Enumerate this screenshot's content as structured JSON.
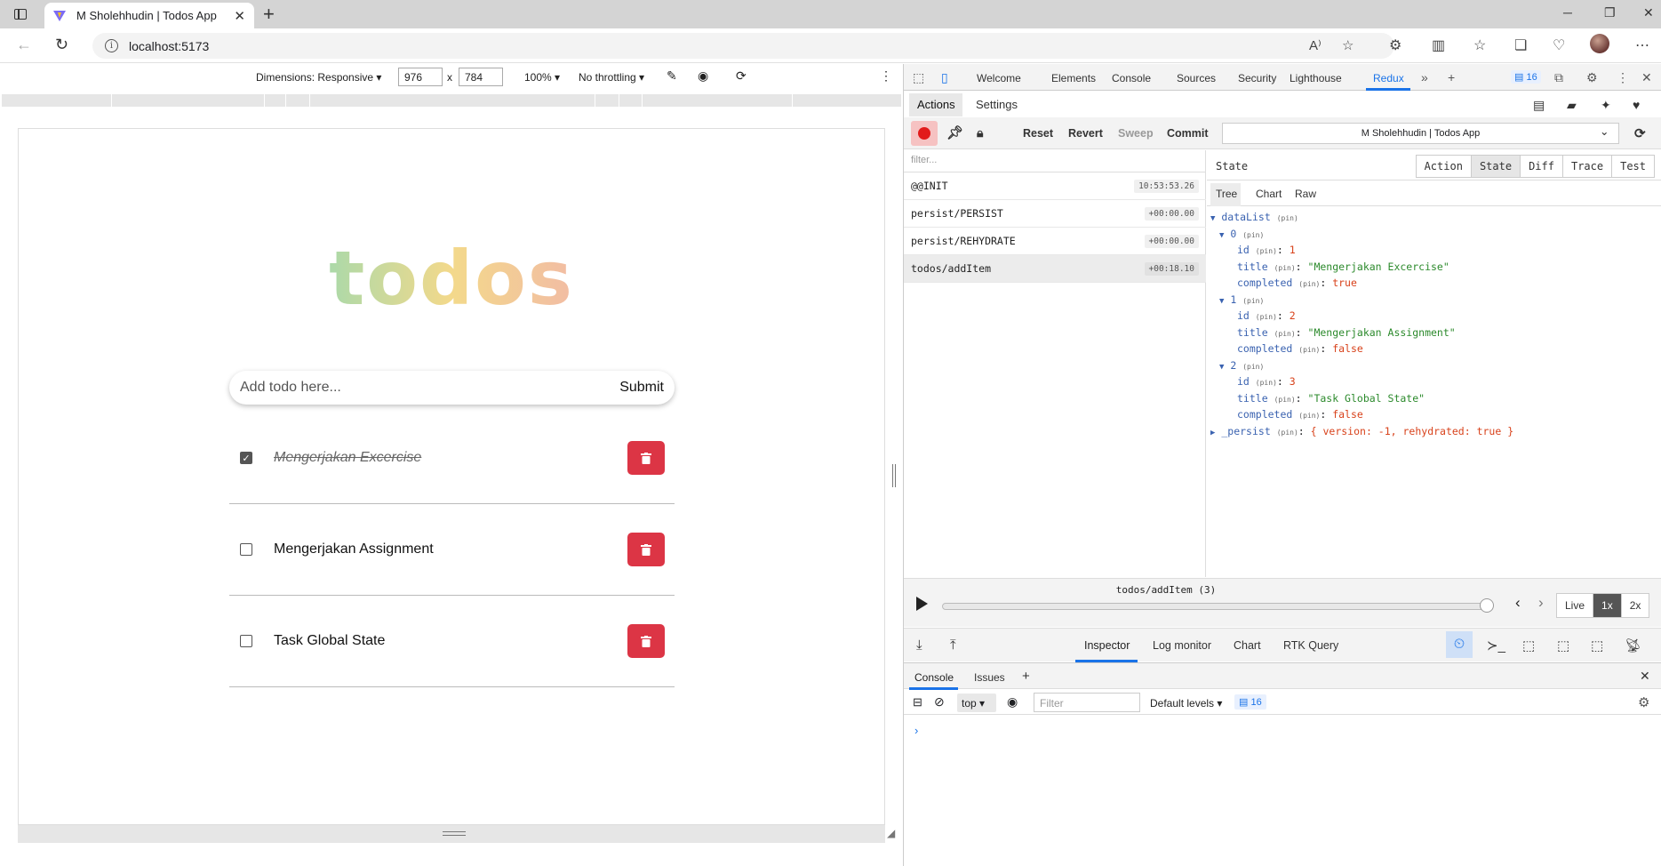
{
  "browser": {
    "tab_title": "M Sholehhudin | Todos App",
    "url": "localhost:5173"
  },
  "device_toolbar": {
    "dimensions_label": "Dimensions: Responsive",
    "width": "976",
    "height": "784",
    "times": "x",
    "zoom": "100%",
    "throttling": "No throttling"
  },
  "app": {
    "logo": "todos",
    "input_placeholder": "Add todo here...",
    "submit_label": "Submit",
    "todos": [
      {
        "title": "Mengerjakan Excercise",
        "completed": true
      },
      {
        "title": "Mengerjakan Assignment",
        "completed": false
      },
      {
        "title": "Task Global State",
        "completed": false
      }
    ]
  },
  "devtools": {
    "tabs": [
      "Welcome",
      "Elements",
      "Console",
      "Sources",
      "Security",
      "Lighthouse",
      "Redux"
    ],
    "active_tab": "Redux",
    "issues_count": "16",
    "redux": {
      "top_tabs": [
        "Actions",
        "Settings"
      ],
      "buttons": {
        "reset": "Reset",
        "revert": "Revert",
        "sweep": "Sweep",
        "commit": "Commit"
      },
      "store_name": "M Sholehhudin | Todos App",
      "filter_placeholder": "filter...",
      "actions": [
        {
          "type": "@@INIT",
          "time": "10:53:53.26"
        },
        {
          "type": "persist/PERSIST",
          "time": "+00:00.00"
        },
        {
          "type": "persist/REHYDRATE",
          "time": "+00:00.00"
        },
        {
          "type": "todos/addItem",
          "time": "+00:18.10"
        }
      ],
      "state_title": "State",
      "state_tabs": [
        "Action",
        "State",
        "Diff",
        "Trace",
        "Test"
      ],
      "sub_tabs": [
        "Tree",
        "Chart",
        "Raw"
      ],
      "tree": {
        "root_key": "dataList",
        "pin": "(pin)",
        "items": [
          {
            "index": "0",
            "id": "1",
            "title": "\"Mengerjakan Excercise\"",
            "completed": "true"
          },
          {
            "index": "1",
            "id": "2",
            "title": "\"Mengerjakan Assignment\"",
            "completed": "false"
          },
          {
            "index": "2",
            "id": "3",
            "title": "\"Task Global State\"",
            "completed": "false"
          }
        ],
        "keys": {
          "id": "id",
          "title": "title",
          "completed": "completed"
        },
        "persist_key": "_persist",
        "persist_value": "{ version: -1, rehydrated: true }"
      },
      "slider_label": "todos/addItem (3)",
      "speeds": [
        "Live",
        "1x",
        "2x"
      ],
      "monitors": [
        "Inspector",
        "Log monitor",
        "Chart",
        "RTK Query"
      ]
    },
    "drawer": {
      "tabs": [
        "Console",
        "Issues"
      ],
      "context": "top",
      "filter_placeholder": "Filter",
      "levels": "Default levels",
      "badge": "16",
      "prompt": "›"
    }
  }
}
